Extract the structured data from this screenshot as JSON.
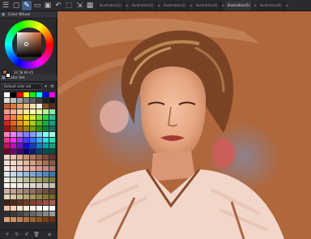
{
  "toolbar": {
    "icons": [
      "menu-icon",
      "new-file-icon",
      "brush-tool-icon",
      "open-folder-icon",
      "save-icon",
      "undo-icon",
      "selection-icon",
      "transform-icon",
      "grid-icon",
      "fill-icon",
      "ruler-icon",
      "eye-icon",
      "settings-icon"
    ]
  },
  "tabs": [
    {
      "label": "Illustration(1)",
      "active": false
    },
    {
      "label": "Illustration(2)",
      "active": false
    },
    {
      "label": "Illustration(3)",
      "active": false
    },
    {
      "label": "Illustration(4)",
      "active": false
    },
    {
      "label": "Illustration(5)",
      "active": true
    },
    {
      "label": "Illustration(6)",
      "active": false
    }
  ],
  "color_wheel_panel": {
    "title": "Color Wheel",
    "hsv_readout": "24  58  69  45",
    "main_color": "#b0673c",
    "sub_color": "#ffffff"
  },
  "color_set_panel": {
    "title": "Color Set",
    "selected_set": "Default color set"
  },
  "canvas": {
    "background_color": "#b0673c"
  },
  "swatches": [
    "#ffffff",
    "#000000",
    "#ff0000",
    "#ffff00",
    "#00ff00",
    "#00ffff",
    "#0000ff",
    "#ff00ff",
    "#e0e0e0",
    "#bfbfbf",
    "#a0a0a0",
    "#808080",
    "#606060",
    "#404040",
    "#202020",
    "#101010",
    "#c85a2a",
    "#d97a3a",
    "#e5a05a",
    "#f0c080",
    "#f6dcb0",
    "#fff0d8",
    "#8a4a2a",
    "#5a2a18",
    "#ff9a8a",
    "#ffb090",
    "#ffd0a0",
    "#ffe6a0",
    "#fff6b0",
    "#e6ff9a",
    "#b8f09a",
    "#8ae6a0",
    "#ff6060",
    "#ff8040",
    "#ffb020",
    "#ffe020",
    "#d0f020",
    "#80e030",
    "#30d050",
    "#20c090",
    "#e02020",
    "#f06010",
    "#f09010",
    "#e0c010",
    "#a8d010",
    "#50c020",
    "#10b040",
    "#10a080",
    "#a01010",
    "#b04010",
    "#b06010",
    "#a08010",
    "#70a010",
    "#309010",
    "#108030",
    "#107060",
    "#ff80c0",
    "#ff80ff",
    "#c080ff",
    "#8080ff",
    "#80a0ff",
    "#80d0ff",
    "#80ffff",
    "#a0ffe0",
    "#ff3090",
    "#ff30ff",
    "#a030ff",
    "#4040ff",
    "#3070ff",
    "#30b0ff",
    "#20e0e0",
    "#20e0b0",
    "#c01060",
    "#c010c0",
    "#7010c0",
    "#1010c0",
    "#1040c0",
    "#1080c0",
    "#10a0a0",
    "#10a080",
    "#700030",
    "#700070",
    "#400070",
    "#000070",
    "#002070",
    "#004070",
    "#005050",
    "#005040",
    "#f0d0c0",
    "#e8c0a8",
    "#d8a888",
    "#c89070",
    "#b07858",
    "#986048",
    "#804838",
    "#683028",
    "#f8e0d0",
    "#f0d8c8",
    "#e8c8b0",
    "#e0b898",
    "#d0a080",
    "#c08868",
    "#a87050",
    "#905840",
    "#ffe8e0",
    "#ffd8d0",
    "#f8c8c0",
    "#f0b8b0",
    "#e8a8a0",
    "#d89890",
    "#c88880",
    "#b07870",
    "#e0e8f0",
    "#c8d8e8",
    "#b0c8e0",
    "#98b8d8",
    "#80a8d0",
    "#6898c8",
    "#5088c0",
    "#3878b0",
    "#f0f0e0",
    "#e0e0c8",
    "#d0d0b0",
    "#c0c098",
    "#b0b080",
    "#a0a068",
    "#909050",
    "#808038",
    "#fff8f0",
    "#f8f0e8",
    "#f0e8e0",
    "#e8e0d8",
    "#e0d8d0",
    "#d8d0c8",
    "#d0c8c0",
    "#c8c0b8",
    "#d0b0a0",
    "#c0a090",
    "#b09080",
    "#a08070",
    "#907060",
    "#806050",
    "#705040",
    "#604030",
    "#e8d8b8",
    "#d8c8a0",
    "#c8b888",
    "#b8a870",
    "#a89858",
    "#988840",
    "#887830",
    "#786820",
    "#402010",
    "#502818",
    "#603020",
    "#703828",
    "#804030",
    "#904838",
    "#a05040",
    "#b05848",
    "#f0c0a0",
    "#f8d0b0",
    "#ffe0c0",
    "#ffe8d0",
    "#fff0e0",
    "#fff4e8",
    "#fff8f0",
    "#fffcf8",
    "#303030",
    "#383838",
    "#484848",
    "#585858",
    "#686868",
    "#787878",
    "#888888",
    "#989898",
    "#e0a070",
    "#d09060",
    "#c08050",
    "#b07040",
    "#a06030",
    "#905020",
    "#804010",
    "#703000"
  ]
}
